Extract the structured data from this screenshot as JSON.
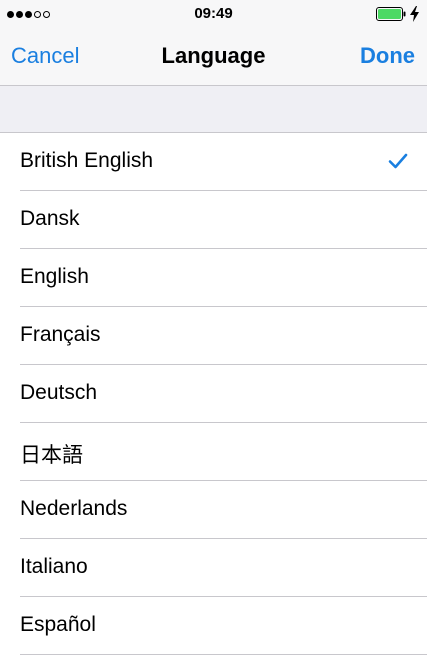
{
  "status_bar": {
    "time": "09:49",
    "signal_filled": 3,
    "signal_total": 5,
    "battery_level": 1.0,
    "battery_color": "#4cd964"
  },
  "nav": {
    "cancel_label": "Cancel",
    "title": "Language",
    "done_label": "Done",
    "accent_color": "#1a7fe0"
  },
  "languages": {
    "items": [
      {
        "label": "British English",
        "selected": true
      },
      {
        "label": "Dansk",
        "selected": false
      },
      {
        "label": "English",
        "selected": false
      },
      {
        "label": "Français",
        "selected": false
      },
      {
        "label": "Deutsch",
        "selected": false
      },
      {
        "label": "日本語",
        "selected": false
      },
      {
        "label": "Nederlands",
        "selected": false
      },
      {
        "label": "Italiano",
        "selected": false
      },
      {
        "label": "Español",
        "selected": false
      }
    ]
  },
  "icons": {
    "checkmark": "checkmark-icon",
    "battery": "battery-icon",
    "charging": "charging-bolt-icon",
    "signal": "signal-dots-icon"
  }
}
